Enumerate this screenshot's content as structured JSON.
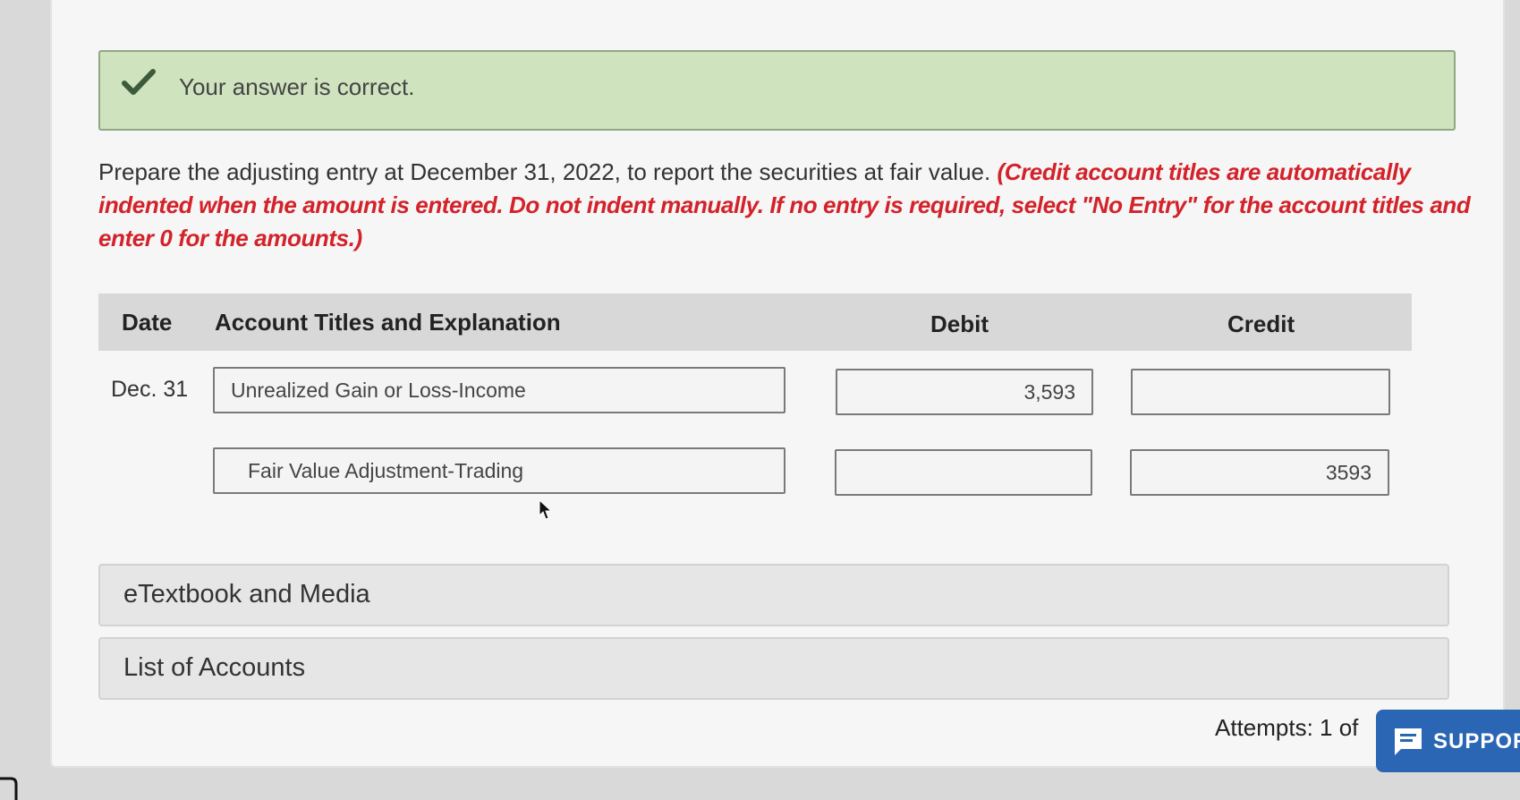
{
  "banner": {
    "message": "Your answer is correct.",
    "icon": "checkmark-icon",
    "color": "#cfe3bf"
  },
  "prompt": {
    "text": "Prepare the adjusting entry at December 31, 2022, to report the securities at fair value.",
    "note": "(Credit account titles are automatically indented when the amount is entered. Do not indent manually. If no entry is required, select \"No Entry\" for the account titles and enter 0 for the amounts.)"
  },
  "table": {
    "headers": {
      "date": "Date",
      "account": "Account Titles and Explanation",
      "debit": "Debit",
      "credit": "Credit"
    },
    "rows": [
      {
        "date": "Dec. 31",
        "account": "Unrealized Gain or Loss-Income",
        "debit": "3,593",
        "credit": ""
      },
      {
        "date": "",
        "account": "Fair Value Adjustment-Trading",
        "debit": "",
        "credit": "3593"
      }
    ]
  },
  "sections": {
    "etextbook": "eTextbook and Media",
    "accounts": "List of Accounts"
  },
  "footer": {
    "attempts": "Attempts: 1 of",
    "support": "SUPPOR",
    "support_icon": "chat-icon",
    "support_color": "#2a66b4"
  }
}
